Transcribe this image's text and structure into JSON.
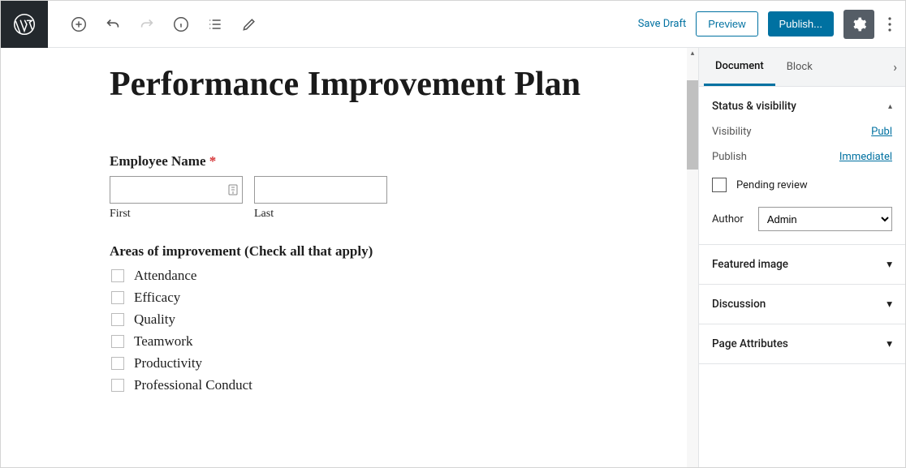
{
  "toolbar": {
    "save_draft": "Save Draft",
    "preview": "Preview",
    "publish": "Publish..."
  },
  "editor": {
    "title": "Performance Improvement Plan",
    "employee_name_label": "Employee Name",
    "required_mark": "*",
    "first_label": "First",
    "last_label": "Last",
    "areas_label": "Areas of improvement (Check all that apply)",
    "checks": [
      "Attendance",
      "Efficacy",
      "Quality",
      "Teamwork",
      "Productivity",
      "Professional Conduct"
    ]
  },
  "sidebar": {
    "tabs": {
      "document": "Document",
      "block": "Block"
    },
    "status_visibility": "Status & visibility",
    "visibility_label": "Visibility",
    "visibility_value": "Publ",
    "publish_label": "Publish",
    "publish_value": "Immediatel",
    "pending_label": "Pending review",
    "author_label": "Author",
    "author_value": "Admin",
    "featured_image": "Featured image",
    "discussion": "Discussion",
    "page_attributes": "Page Attributes"
  }
}
